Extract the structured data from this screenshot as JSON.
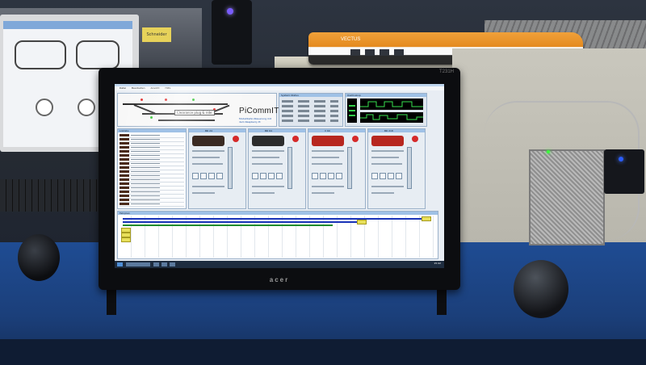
{
  "photo": {
    "train_livery_text": "VECTUS",
    "sticker_text": "Schneider",
    "monitor_brand": "acer",
    "monitor_model": "T231H"
  },
  "app": {
    "menu": [
      "Datei",
      "Bearbeiten",
      "Ansicht",
      "Hilfe"
    ],
    "brand_name": "PiCommIT",
    "brand_tagline": "Modellbahn-Steuerung mit dem Raspberry Pi",
    "route_label": "Clearance plug & ride",
    "status_panel_title": "System-Status",
    "scope_panel_title": "Oszilloskop",
    "loco_list_title": "Lokliste",
    "cabs": [
      {
        "name": "BR 24",
        "color": "#3a2a22"
      },
      {
        "name": "BR 64",
        "color": "#2c2c2c"
      },
      {
        "name": "V 60",
        "color": "#b7271f"
      },
      {
        "name": "BR 218",
        "color": "#b7271f"
      }
    ],
    "timeline_title": "Fahrplan",
    "clock": "15:42"
  },
  "colors": {
    "accent": "#9fc1e6",
    "track_blue": "#1a34b8",
    "track_green": "#1f8a2d",
    "signal_red": "#e02020",
    "signal_green": "#20c020"
  }
}
